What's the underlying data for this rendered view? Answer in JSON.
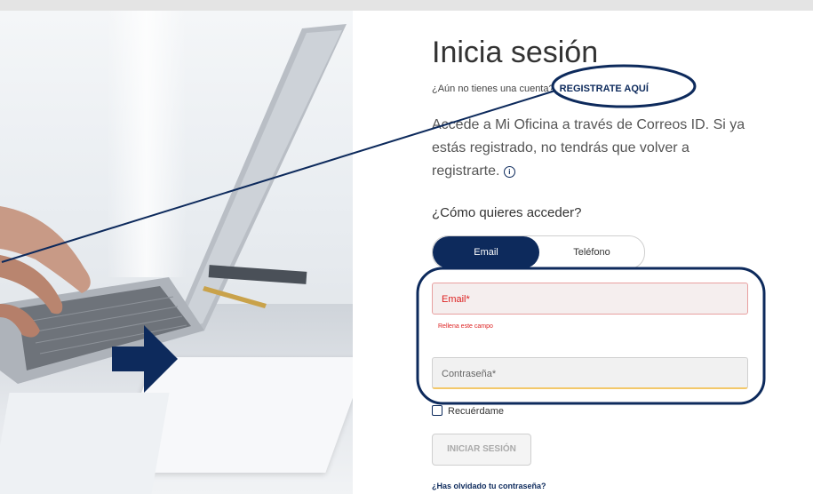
{
  "header": {
    "title": "Inicia sesión"
  },
  "register": {
    "prompt": "¿Aún no tienes una cuenta?",
    "link": "REGISTRATE AQUÍ"
  },
  "description": "Accede a Mi Oficina a través de Correos ID. Si ya estás registrado, no tendrás que volver a registrarte.",
  "info_icon": "info-icon",
  "access": {
    "question": "¿Cómo quieres acceder?",
    "options": [
      {
        "label": "Email",
        "active": true
      },
      {
        "label": "Teléfono",
        "active": false
      }
    ]
  },
  "form": {
    "email_label": "Email*",
    "email_error": "Rellena este campo",
    "password_label": "Contraseña*",
    "remember_label": "Recuérdame",
    "submit_label": "INICIAR SESIÓN",
    "forgot_label": "¿Has olvidado tu contraseña?"
  },
  "colors": {
    "brand": "#0d2a5c",
    "error": "#dd2222",
    "annotation": "#0d2a5c"
  }
}
